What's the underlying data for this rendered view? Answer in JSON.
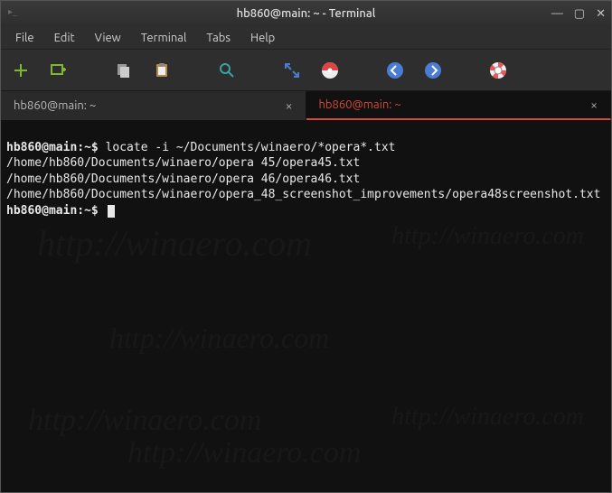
{
  "window": {
    "title": "hb860@main: ~ - Terminal"
  },
  "menubar": {
    "items": [
      "File",
      "Edit",
      "View",
      "Terminal",
      "Tabs",
      "Help"
    ]
  },
  "tabs": [
    {
      "label": "hb860@main: ~",
      "active": false
    },
    {
      "label": "hb860@main: ~",
      "active": true
    }
  ],
  "terminal": {
    "prompt": "hb860@main:~$",
    "command": "locate -i ~/Documents/winaero/*opera*.txt",
    "output": [
      "/home/hb860/Documents/winaero/opera 45/opera45.txt",
      "/home/hb860/Documents/winaero/opera 46/opera46.txt",
      "/home/hb860/Documents/winaero/opera_48_screenshot_improvements/opera48screenshot.txt"
    ],
    "prompt2": "hb860@main:~$"
  },
  "watermark": "http://winaero.com"
}
